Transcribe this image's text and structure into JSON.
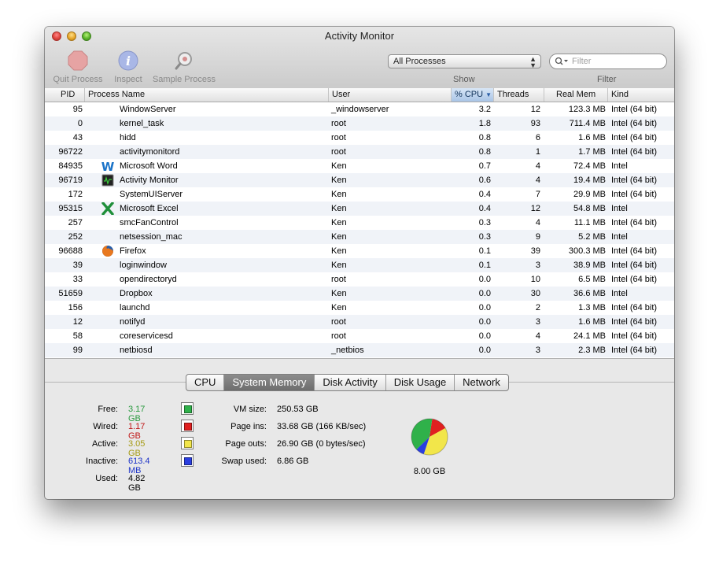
{
  "window": {
    "title": "Activity Monitor"
  },
  "toolbar": {
    "quit_label": "Quit Process",
    "inspect_label": "Inspect",
    "sample_label": "Sample Process",
    "show_select": "All Processes",
    "search_placeholder": "Filter",
    "show_label": "Show",
    "filter_label": "Filter"
  },
  "table": {
    "columns": [
      "PID",
      "Process Name",
      "User",
      "% CPU",
      "Threads",
      "Real Mem",
      "Kind"
    ],
    "rows": [
      {
        "pid": "95",
        "name": "WindowServer",
        "user": "_windowserver",
        "cpu": "3.2",
        "threads": "12",
        "mem": "123.3 MB",
        "kind": "Intel (64 bit)",
        "icon": ""
      },
      {
        "pid": "0",
        "name": "kernel_task",
        "user": "root",
        "cpu": "1.8",
        "threads": "93",
        "mem": "711.4 MB",
        "kind": "Intel (64 bit)",
        "icon": ""
      },
      {
        "pid": "43",
        "name": "hidd",
        "user": "root",
        "cpu": "0.8",
        "threads": "6",
        "mem": "1.6 MB",
        "kind": "Intel (64 bit)",
        "icon": ""
      },
      {
        "pid": "96722",
        "name": "activitymonitord",
        "user": "root",
        "cpu": "0.8",
        "threads": "1",
        "mem": "1.7 MB",
        "kind": "Intel (64 bit)",
        "icon": ""
      },
      {
        "pid": "84935",
        "name": "Microsoft Word",
        "user": "Ken",
        "cpu": "0.7",
        "threads": "4",
        "mem": "72.4 MB",
        "kind": "Intel",
        "icon": "word-icon"
      },
      {
        "pid": "96719",
        "name": "Activity Monitor",
        "user": "Ken",
        "cpu": "0.6",
        "threads": "4",
        "mem": "19.4 MB",
        "kind": "Intel (64 bit)",
        "icon": "activity-monitor-icon"
      },
      {
        "pid": "172",
        "name": "SystemUIServer",
        "user": "Ken",
        "cpu": "0.4",
        "threads": "7",
        "mem": "29.9 MB",
        "kind": "Intel (64 bit)",
        "icon": ""
      },
      {
        "pid": "95315",
        "name": "Microsoft Excel",
        "user": "Ken",
        "cpu": "0.4",
        "threads": "12",
        "mem": "54.8 MB",
        "kind": "Intel",
        "icon": "excel-icon"
      },
      {
        "pid": "257",
        "name": "smcFanControl",
        "user": "Ken",
        "cpu": "0.3",
        "threads": "4",
        "mem": "11.1 MB",
        "kind": "Intel (64 bit)",
        "icon": ""
      },
      {
        "pid": "252",
        "name": "netsession_mac",
        "user": "Ken",
        "cpu": "0.3",
        "threads": "9",
        "mem": "5.2 MB",
        "kind": "Intel",
        "icon": ""
      },
      {
        "pid": "96688",
        "name": "Firefox",
        "user": "Ken",
        "cpu": "0.1",
        "threads": "39",
        "mem": "300.3 MB",
        "kind": "Intel (64 bit)",
        "icon": "firefox-icon"
      },
      {
        "pid": "39",
        "name": "loginwindow",
        "user": "Ken",
        "cpu": "0.1",
        "threads": "3",
        "mem": "38.9 MB",
        "kind": "Intel (64 bit)",
        "icon": ""
      },
      {
        "pid": "33",
        "name": "opendirectoryd",
        "user": "root",
        "cpu": "0.0",
        "threads": "10",
        "mem": "6.5 MB",
        "kind": "Intel (64 bit)",
        "icon": ""
      },
      {
        "pid": "51659",
        "name": "Dropbox",
        "user": "Ken",
        "cpu": "0.0",
        "threads": "30",
        "mem": "36.6 MB",
        "kind": "Intel",
        "icon": ""
      },
      {
        "pid": "156",
        "name": "launchd",
        "user": "Ken",
        "cpu": "0.0",
        "threads": "2",
        "mem": "1.3 MB",
        "kind": "Intel (64 bit)",
        "icon": ""
      },
      {
        "pid": "12",
        "name": "notifyd",
        "user": "root",
        "cpu": "0.0",
        "threads": "3",
        "mem": "1.6 MB",
        "kind": "Intel (64 bit)",
        "icon": ""
      },
      {
        "pid": "58",
        "name": "coreservicesd",
        "user": "root",
        "cpu": "0.0",
        "threads": "4",
        "mem": "24.1 MB",
        "kind": "Intel (64 bit)",
        "icon": ""
      },
      {
        "pid": "99",
        "name": "netbiosd",
        "user": "_netbios",
        "cpu": "0.0",
        "threads": "3",
        "mem": "2.3 MB",
        "kind": "Intel (64 bit)",
        "icon": ""
      }
    ]
  },
  "tabs": [
    "CPU",
    "System Memory",
    "Disk Activity",
    "Disk Usage",
    "Network"
  ],
  "active_tab": "System Memory",
  "memory": {
    "free_label": "Free:",
    "free_value": "3.17 GB",
    "free_color": "#2fb14a",
    "wired_label": "Wired:",
    "wired_value": "1.17 GB",
    "wired_color": "#e02020",
    "active_label": "Active:",
    "active_value": "3.05 GB",
    "active_color": "#f2e64a",
    "inactive_label": "Inactive:",
    "inactive_value": "613.4 MB",
    "inactive_color": "#2a3ee0",
    "used_label": "Used:",
    "used_value": "4.82 GB",
    "vm_size_label": "VM size:",
    "vm_size_value": "250.53 GB",
    "page_ins_label": "Page ins:",
    "page_ins_value": "33.68 GB (166 KB/sec)",
    "page_outs_label": "Page outs:",
    "page_outs_value": "26.90 GB (0 bytes/sec)",
    "swap_label": "Swap used:",
    "swap_value": "6.86 GB",
    "total": "8.00 GB"
  },
  "chart_data": {
    "type": "pie",
    "categories": [
      "Free",
      "Wired",
      "Active",
      "Inactive"
    ],
    "values": [
      3.17,
      1.17,
      3.05,
      0.6134
    ],
    "colors": [
      "#2fb14a",
      "#e02020",
      "#f2e64a",
      "#2a3ee0"
    ]
  }
}
